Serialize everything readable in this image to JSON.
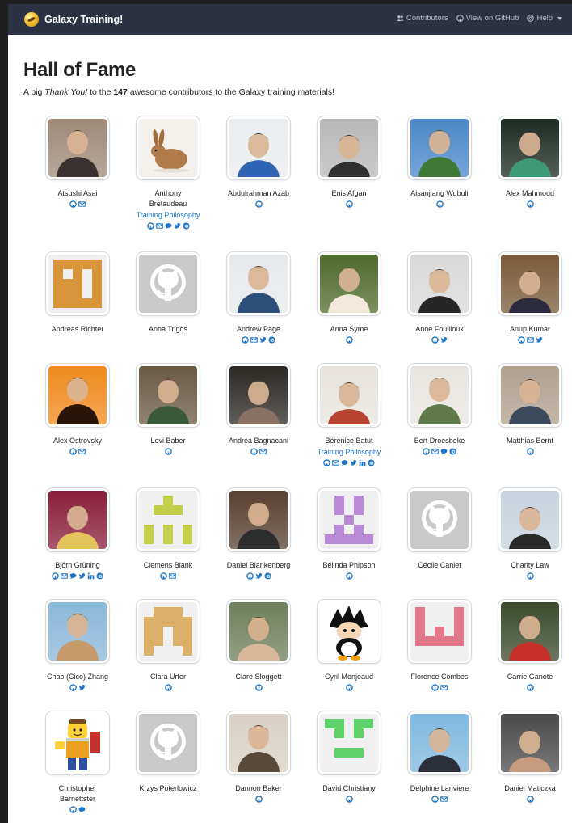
{
  "nav": {
    "brand": "Galaxy Training!",
    "contributors": "Contributors",
    "github": "View on GitHub",
    "help": "Help"
  },
  "page": {
    "title": "Hall of Fame",
    "intro_prefix": "A big ",
    "intro_thanks": "Thank You!",
    "intro_middle": " to the ",
    "intro_count": "147",
    "intro_suffix": " awesome contributors to the Galaxy training materials!"
  },
  "colors": {
    "link": "#1a73c8",
    "navbar": "#2c3143"
  },
  "contributors": [
    {
      "name": "Atsushi Asai",
      "role": "",
      "links": [
        "github",
        "email"
      ],
      "avatar": "photo",
      "c1": "#a08a78",
      "c2": "#3a3230"
    },
    {
      "name": "Anthony Bretaudeau",
      "role": "Training Philosophy",
      "links": [
        "github",
        "email",
        "chat",
        "twitter",
        "orcid"
      ],
      "avatar": "rabbit",
      "c1": "#f4f1ec",
      "c2": "#b07a4a"
    },
    {
      "name": "Abdulrahman Azab",
      "role": "",
      "links": [
        "github"
      ],
      "avatar": "photo",
      "c1": "#e9ecef",
      "c2": "#2f63b3"
    },
    {
      "name": "Enis Afgan",
      "role": "",
      "links": [
        "github"
      ],
      "avatar": "photo",
      "c1": "#b8b8b8",
      "c2": "#303030"
    },
    {
      "name": "Aisanjiang Wubuli",
      "role": "",
      "links": [
        "github"
      ],
      "avatar": "photo",
      "c1": "#4b87c9",
      "c2": "#3f7a35"
    },
    {
      "name": "Alex Mahmoud",
      "role": "",
      "links": [
        "github"
      ],
      "avatar": "photo",
      "c1": "#1d2a22",
      "c2": "#3c9a78"
    },
    {
      "name": "Andreas Richter",
      "role": "",
      "links": [],
      "avatar": "identicon",
      "c1": "#d9953a",
      "pattern": "1111110101111011110111111"
    },
    {
      "name": "Anna Trigos",
      "role": "",
      "links": [],
      "avatar": "octocat",
      "c1": "#c9c9c9"
    },
    {
      "name": "Andrew Page",
      "role": "",
      "links": [
        "github",
        "email",
        "twitter",
        "orcid"
      ],
      "avatar": "photo",
      "c1": "#e6e9ec",
      "c2": "#2c4f7a"
    },
    {
      "name": "Anna Syme",
      "role": "",
      "links": [
        "github"
      ],
      "avatar": "photo",
      "c1": "#4e6b2a",
      "c2": "#f1eadb"
    },
    {
      "name": "Anne Fouilloux",
      "role": "",
      "links": [
        "github",
        "twitter"
      ],
      "avatar": "photo",
      "c1": "#d8d8d8",
      "c2": "#262626"
    },
    {
      "name": "Anup Kumar",
      "role": "",
      "links": [
        "github",
        "email",
        "twitter"
      ],
      "avatar": "photo",
      "c1": "#7a5a3a",
      "c2": "#2b2b3d"
    },
    {
      "name": "Alex Ostrovsky",
      "role": "",
      "links": [
        "github",
        "email"
      ],
      "avatar": "photo",
      "c1": "#f08a1c",
      "c2": "#2a1408"
    },
    {
      "name": "Levi Baber",
      "role": "",
      "links": [
        "github"
      ],
      "avatar": "photo",
      "c1": "#6b5a44",
      "c2": "#3a5a3a"
    },
    {
      "name": "Andrea Bagnacani",
      "role": "",
      "links": [
        "github",
        "email"
      ],
      "avatar": "photo",
      "c1": "#2c2824",
      "c2": "#8a7060"
    },
    {
      "name": "Bérénice Batut",
      "role": "Training Philosophy",
      "links": [
        "github",
        "email",
        "chat",
        "twitter",
        "linkedin",
        "orcid"
      ],
      "avatar": "photo",
      "c1": "#e7e2dc",
      "c2": "#b8442f"
    },
    {
      "name": "Bert Droesbeke",
      "role": "",
      "links": [
        "github",
        "email",
        "chat",
        "orcid"
      ],
      "avatar": "photo",
      "c1": "#e8e5e0",
      "c2": "#5e7a4a"
    },
    {
      "name": "Matthias Bernt",
      "role": "",
      "links": [
        "github"
      ],
      "avatar": "photo",
      "c1": "#b0a08e",
      "c2": "#3c4a5e"
    },
    {
      "name": "Björn Grüning",
      "role": "",
      "links": [
        "github",
        "email",
        "chat",
        "twitter",
        "linkedin",
        "orcid"
      ],
      "avatar": "photo",
      "c1": "#8a1e3a",
      "c2": "#e3c35a"
    },
    {
      "name": "Clemens Blank",
      "role": "",
      "links": [
        "github",
        "email"
      ],
      "avatar": "identicon",
      "c1": "#c3cf4a",
      "pattern": "0010001110000001010110101"
    },
    {
      "name": "Daniel Blankenberg",
      "role": "",
      "links": [
        "github",
        "twitter",
        "orcid"
      ],
      "avatar": "photo",
      "c1": "#5a4030",
      "c2": "#2d2d2d"
    },
    {
      "name": "Belinda Phipson",
      "role": "",
      "links": [
        "github"
      ],
      "avatar": "identicon",
      "c1": "#b98bd6",
      "pattern": "0101001010001000101011111"
    },
    {
      "name": "Cécile Canlet",
      "role": "",
      "links": [],
      "avatar": "octocat",
      "c1": "#c9c9c9"
    },
    {
      "name": "Charity Law",
      "role": "",
      "links": [
        "github"
      ],
      "avatar": "photo",
      "c1": "#c7d2dc",
      "c2": "#2a2a2a"
    },
    {
      "name": "Chao (Cico) Zhang",
      "role": "",
      "links": [
        "github",
        "twitter"
      ],
      "avatar": "photo",
      "c1": "#8ab7d9",
      "c2": "#c79a6a"
    },
    {
      "name": "Clara Urfer",
      "role": "",
      "links": [
        "github"
      ],
      "avatar": "identicon",
      "c1": "#ddb06a",
      "pattern": "0111011111110111101110001"
    },
    {
      "name": "Clare Sloggett",
      "role": "",
      "links": [
        "github"
      ],
      "avatar": "photo",
      "c1": "#6f7f5a",
      "c2": "#d9b89a"
    },
    {
      "name": "Cyril Monjeaud",
      "role": "",
      "links": [
        "github"
      ],
      "avatar": "cartoon",
      "c1": "#ffffff",
      "c2": "#f39c12"
    },
    {
      "name": "Florence Combes",
      "role": "",
      "links": [
        "github",
        "email"
      ],
      "avatar": "identicon",
      "c1": "#e0788a",
      "pattern": "1000110001101011111100000"
    },
    {
      "name": "Carrie Ganote",
      "role": "",
      "links": [
        "github"
      ],
      "avatar": "photo",
      "c1": "#3a4a2a",
      "c2": "#c8302c"
    },
    {
      "name": "Christopher Barnettster",
      "role": "",
      "links": [
        "github",
        "chat"
      ],
      "avatar": "lego",
      "c1": "#ffffff",
      "c2": "#f0a020"
    },
    {
      "name": "Krzys Poterlowicz",
      "role": "",
      "links": [],
      "avatar": "octocat",
      "c1": "#c9c9c9"
    },
    {
      "name": "Dannon Baker",
      "role": "",
      "links": [
        "github"
      ],
      "avatar": "photo",
      "c1": "#d8d0c4",
      "c2": "#5a4a3a"
    },
    {
      "name": "David Christiany",
      "role": "",
      "links": [
        "github"
      ],
      "avatar": "identicon",
      "c1": "#5fd16b",
      "pattern": "1101101010000000111000000"
    },
    {
      "name": "Delphine Lariviere",
      "role": "",
      "links": [
        "github",
        "email"
      ],
      "avatar": "photo",
      "c1": "#7fb8e0",
      "c2": "#2a2f3a"
    },
    {
      "name": "Daniel Maticzka",
      "role": "",
      "links": [
        "github"
      ],
      "avatar": "photo",
      "c1": "#4a4a4a",
      "c2": "#c79a80"
    }
  ]
}
